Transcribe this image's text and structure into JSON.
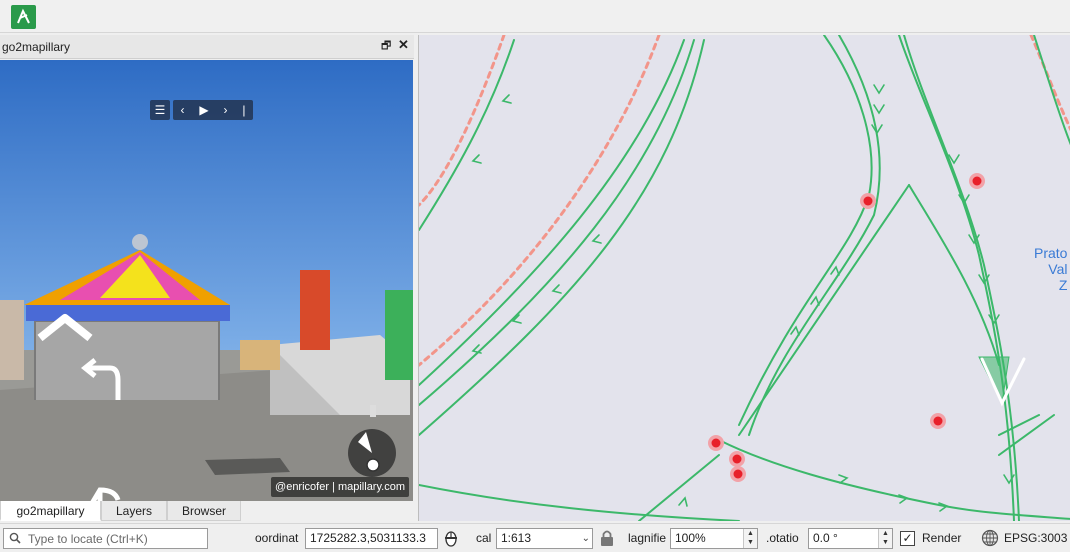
{
  "toolbar": {
    "app_icon": "mapillary-plugin-icon"
  },
  "dock": {
    "title": "go2mapillary",
    "float_icon": "float-window-icon",
    "close_icon": "close-icon",
    "viewer": {
      "nav": {
        "menu": "☰",
        "prev": "‹",
        "play": "▶",
        "next": "›",
        "end": "|"
      },
      "attribution": "@enricofer | mapillary.com"
    },
    "tabs": [
      "go2mapillary",
      "Layers",
      "Browser"
    ]
  },
  "map": {
    "place_label_lines": [
      "Prato",
      "Val",
      "Z"
    ],
    "colors": {
      "sequence": "#3cb86a",
      "point": "#e8202a",
      "point_halo": "#f2a2a8",
      "boundary": "#f2958a",
      "background": "#e3e3ec"
    }
  },
  "statusbar": {
    "locator_placeholder": "Type to locate (Ctrl+K)",
    "coordinate_label": "oordinat",
    "coordinate_value": "1725282.3,5031133.3",
    "scale_label": "cal",
    "scale_value": "1:613",
    "magnifier_label": "lagnifie",
    "magnifier_value": "100%",
    "rotation_label": ".otatio",
    "rotation_value": "0.0 °",
    "render_label": "Render",
    "render_checked": true,
    "crs_label": "EPSG:3003"
  }
}
